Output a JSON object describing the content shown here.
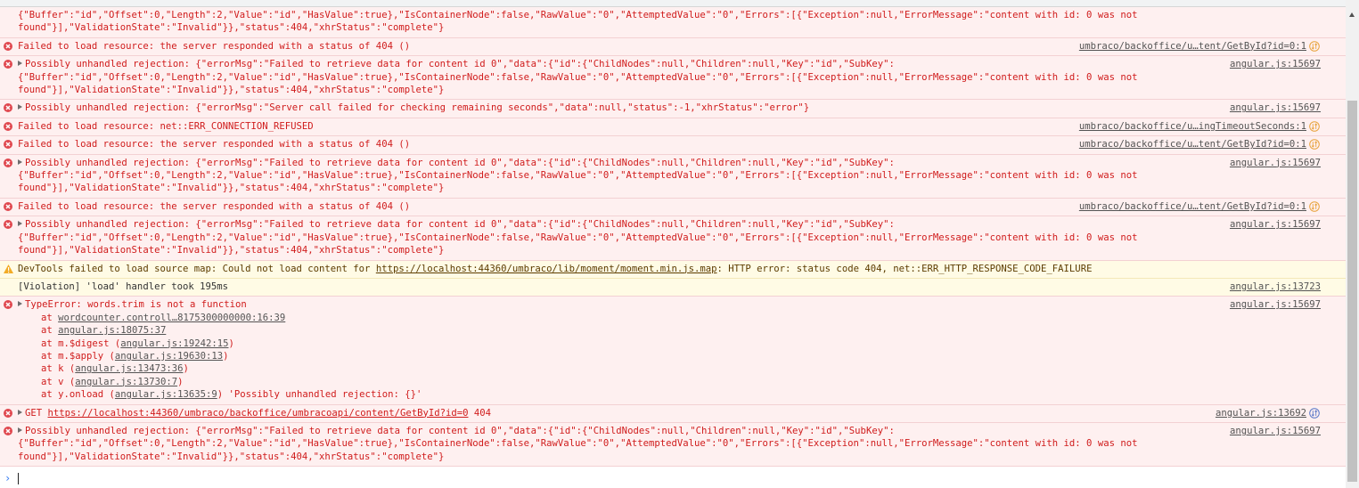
{
  "colors": {
    "error_bg": "#fef0f0",
    "error_text": "#d01c1c",
    "warning_bg": "#fffbe5",
    "warning_text": "#5c3c00",
    "net_icon_orange": "#e8a33d",
    "net_icon_blue": "#5a78c8",
    "prompt_chevron": "#367cf1"
  },
  "console": {
    "rows": [
      {
        "level": "error",
        "icon": "none",
        "expandable": false,
        "lines": [
          "{\"Buffer\":\"id\",\"Offset\":0,\"Length\":2,\"Value\":\"id\",\"HasValue\":true},\"IsContainerNode\":false,\"RawValue\":\"0\",\"AttemptedValue\":\"0\",\"Errors\":[{\"Exception\":null,\"ErrorMessage\":\"content with id: 0 was not",
          "found\"}],\"ValidationState\":\"Invalid\"}},\"status\":404,\"xhrStatus\":\"complete\"}"
        ],
        "source": ""
      },
      {
        "level": "error",
        "icon": "error-circle",
        "expandable": false,
        "text": "Failed to load resource: the server responded with a status of 404 ()",
        "source": "umbraco/backoffice/u…tent/GetById?id=0:1",
        "net_icon": "orange"
      },
      {
        "level": "error",
        "icon": "error-circle",
        "expandable": true,
        "lines": [
          "Possibly unhandled rejection: {\"errorMsg\":\"Failed to retrieve data for content id 0\",\"data\":{\"id\":{\"ChildNodes\":null,\"Children\":null,\"Key\":\"id\",\"SubKey\":",
          "{\"Buffer\":\"id\",\"Offset\":0,\"Length\":2,\"Value\":\"id\",\"HasValue\":true},\"IsContainerNode\":false,\"RawValue\":\"0\",\"AttemptedValue\":\"0\",\"Errors\":[{\"Exception\":null,\"ErrorMessage\":\"content with id: 0 was not",
          "found\"}],\"ValidationState\":\"Invalid\"}},\"status\":404,\"xhrStatus\":\"complete\"}"
        ],
        "source": "angular.js:15697"
      },
      {
        "level": "error",
        "icon": "error-circle",
        "expandable": true,
        "text": "Possibly unhandled rejection: {\"errorMsg\":\"Server call failed for checking remaining seconds\",\"data\":null,\"status\":-1,\"xhrStatus\":\"error\"}",
        "source": "angular.js:15697"
      },
      {
        "level": "error",
        "icon": "error-circle",
        "expandable": false,
        "text": "Failed to load resource: net::ERR_CONNECTION_REFUSED",
        "source": "umbraco/backoffice/u…ingTimeoutSeconds:1",
        "net_icon": "orange"
      },
      {
        "level": "error",
        "icon": "error-circle",
        "expandable": false,
        "text": "Failed to load resource: the server responded with a status of 404 ()",
        "source": "umbraco/backoffice/u…tent/GetById?id=0:1",
        "net_icon": "orange"
      },
      {
        "level": "error",
        "icon": "error-circle",
        "expandable": true,
        "lines": [
          "Possibly unhandled rejection: {\"errorMsg\":\"Failed to retrieve data for content id 0\",\"data\":{\"id\":{\"ChildNodes\":null,\"Children\":null,\"Key\":\"id\",\"SubKey\":",
          "{\"Buffer\":\"id\",\"Offset\":0,\"Length\":2,\"Value\":\"id\",\"HasValue\":true},\"IsContainerNode\":false,\"RawValue\":\"0\",\"AttemptedValue\":\"0\",\"Errors\":[{\"Exception\":null,\"ErrorMessage\":\"content with id: 0 was not",
          "found\"}],\"ValidationState\":\"Invalid\"}},\"status\":404,\"xhrStatus\":\"complete\"}"
        ],
        "source": "angular.js:15697"
      },
      {
        "level": "error",
        "icon": "error-circle",
        "expandable": false,
        "text": "Failed to load resource: the server responded with a status of 404 ()",
        "source": "umbraco/backoffice/u…tent/GetById?id=0:1",
        "net_icon": "orange"
      },
      {
        "level": "error",
        "icon": "error-circle",
        "expandable": true,
        "lines": [
          "Possibly unhandled rejection: {\"errorMsg\":\"Failed to retrieve data for content id 0\",\"data\":{\"id\":{\"ChildNodes\":null,\"Children\":null,\"Key\":\"id\",\"SubKey\":",
          "{\"Buffer\":\"id\",\"Offset\":0,\"Length\":2,\"Value\":\"id\",\"HasValue\":true},\"IsContainerNode\":false,\"RawValue\":\"0\",\"AttemptedValue\":\"0\",\"Errors\":[{\"Exception\":null,\"ErrorMessage\":\"content with id: 0 was not",
          "found\"}],\"ValidationState\":\"Invalid\"}},\"status\":404,\"xhrStatus\":\"complete\"}"
        ],
        "source": "angular.js:15697"
      },
      {
        "level": "warning",
        "icon": "warning-triangle",
        "expandable": false,
        "prefix": "DevTools failed to load source map: Could not load content for ",
        "link": "https://localhost:44360/umbraco/lib/moment/moment.min.js.map",
        "suffix": ": HTTP error: status code 404, net::ERR_HTTP_RESPONSE_CODE_FAILURE",
        "source": ""
      },
      {
        "level": "violation",
        "icon": "none",
        "expandable": false,
        "text": "[Violation] 'load' handler took 195ms",
        "source": "angular.js:13723"
      },
      {
        "level": "error",
        "icon": "error-circle",
        "expandable": true,
        "text": "TypeError: words.trim is not a function",
        "stack": [
          {
            "prefix": "at ",
            "link": "wordcounter.controll…8175300000000:16:39",
            "suffix": ""
          },
          {
            "prefix": "at ",
            "link": "angular.js:18075:37",
            "suffix": ""
          },
          {
            "prefix": "at m.$digest (",
            "link": "angular.js:19242:15",
            "suffix": ")"
          },
          {
            "prefix": "at m.$apply (",
            "link": "angular.js:19630:13",
            "suffix": ")"
          },
          {
            "prefix": "at k (",
            "link": "angular.js:13473:36",
            "suffix": ")"
          },
          {
            "prefix": "at v (",
            "link": "angular.js:13730:7",
            "suffix": ")"
          },
          {
            "prefix": "at y.onload (",
            "link": "angular.js:13635:9",
            "suffix": ") 'Possibly unhandled rejection: {}'"
          }
        ],
        "source": "angular.js:15697"
      },
      {
        "level": "error",
        "icon": "error-circle",
        "expandable": true,
        "prefix": "GET ",
        "link": "https://localhost:44360/umbraco/backoffice/umbracoapi/content/GetById?id=0",
        "suffix": " 404",
        "source": "angular.js:13692",
        "net_icon": "blue"
      },
      {
        "level": "error",
        "icon": "error-circle",
        "expandable": true,
        "lines": [
          "Possibly unhandled rejection: {\"errorMsg\":\"Failed to retrieve data for content id 0\",\"data\":{\"id\":{\"ChildNodes\":null,\"Children\":null,\"Key\":\"id\",\"SubKey\":",
          "{\"Buffer\":\"id\",\"Offset\":0,\"Length\":2,\"Value\":\"id\",\"HasValue\":true},\"IsContainerNode\":false,\"RawValue\":\"0\",\"AttemptedValue\":\"0\",\"Errors\":[{\"Exception\":null,\"ErrorMessage\":\"content with id: 0 was not",
          "found\"}],\"ValidationState\":\"Invalid\"}},\"status\":404,\"xhrStatus\":\"complete\"}"
        ],
        "source": "angular.js:15697"
      }
    ],
    "prompt": {
      "chevron": "›",
      "value": ""
    }
  }
}
